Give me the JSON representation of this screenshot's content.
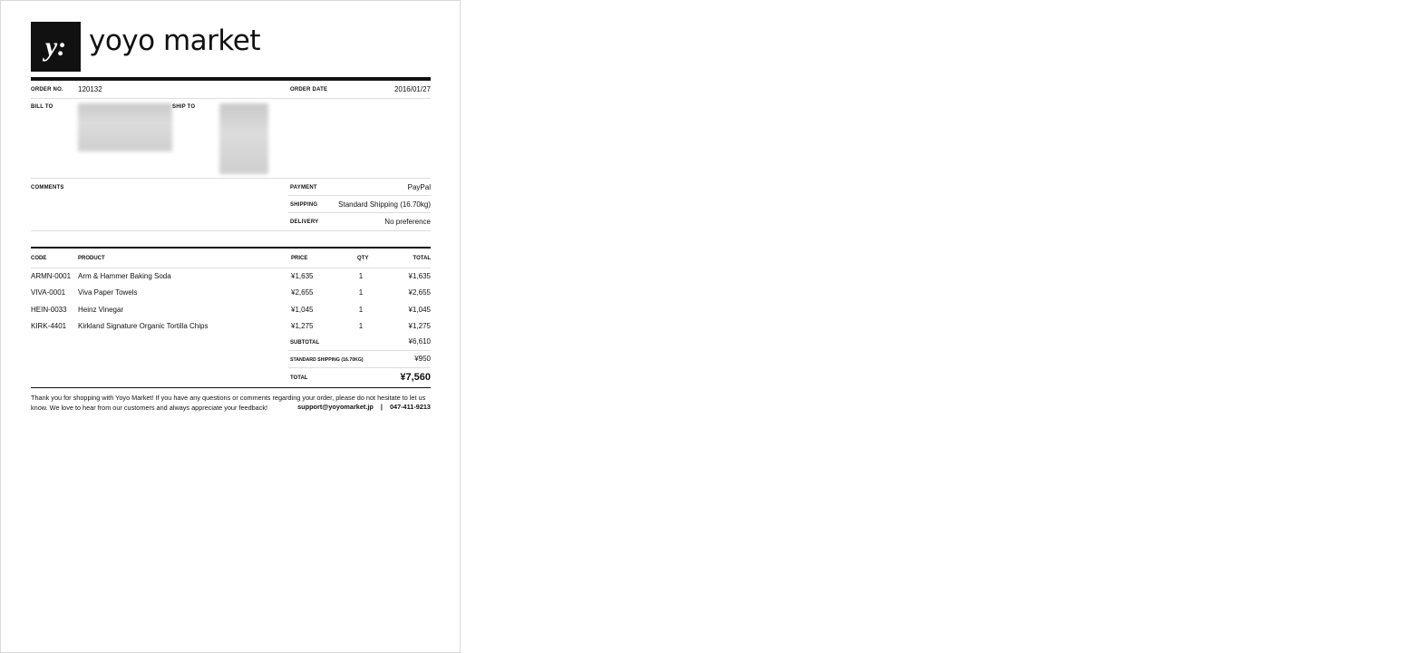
{
  "brand": {
    "logo_mark": "y:",
    "name": "yoyo market"
  },
  "order": {
    "no_label": "ORDER NO.",
    "no": "120132",
    "date_label": "ORDER DATE",
    "date": "2016/01/27",
    "bill_to_label": "BILL TO",
    "ship_to_label": "SHIP TO",
    "comments_label": "COMMENTS",
    "payment_label": "PAYMENT",
    "payment": "PayPal",
    "shipping_label": "SHIPPING",
    "shipping": "Standard Shipping (16.70kg)",
    "delivery_label": "DELIVERY",
    "delivery": "No preference"
  },
  "items_table": {
    "headers": {
      "code": "CODE",
      "product": "PRODUCT",
      "price": "PRICE",
      "qty": "QTY",
      "total": "TOTAL"
    },
    "rows": [
      {
        "code": "ARMN-0001",
        "product": "Arm & Hammer Baking Soda",
        "price": "¥1,635",
        "qty": "1",
        "total": "¥1,635"
      },
      {
        "code": "VIVA-0001",
        "product": "Viva Paper Towels",
        "price": "¥2,655",
        "qty": "1",
        "total": "¥2,655"
      },
      {
        "code": "HEIN-0033",
        "product": "Heinz Vinegar",
        "price": "¥1,045",
        "qty": "1",
        "total": "¥1,045"
      },
      {
        "code": "KIRK-4401",
        "product": "Kirkland Signature Organic Tortilla Chips",
        "price": "¥1,275",
        "qty": "1",
        "total": "¥1,275"
      }
    ]
  },
  "totals": {
    "subtotal_label": "SUBTOTAL",
    "subtotal": "¥6,610",
    "shipping_label": "STANDARD SHIPPING (16.70KG)",
    "shipping": "¥950",
    "total_label": "TOTAL",
    "total": "¥7,560"
  },
  "footer": {
    "message": "Thank you for shopping with Yoyo Market!  If you have any questions or comments regarding your order, please do not hesitate to let us know.  We love to hear from our customers and always appreciate your feedback!",
    "email": "support@yoyomarket.jp",
    "separator": "|",
    "phone": "047-411-9213"
  }
}
